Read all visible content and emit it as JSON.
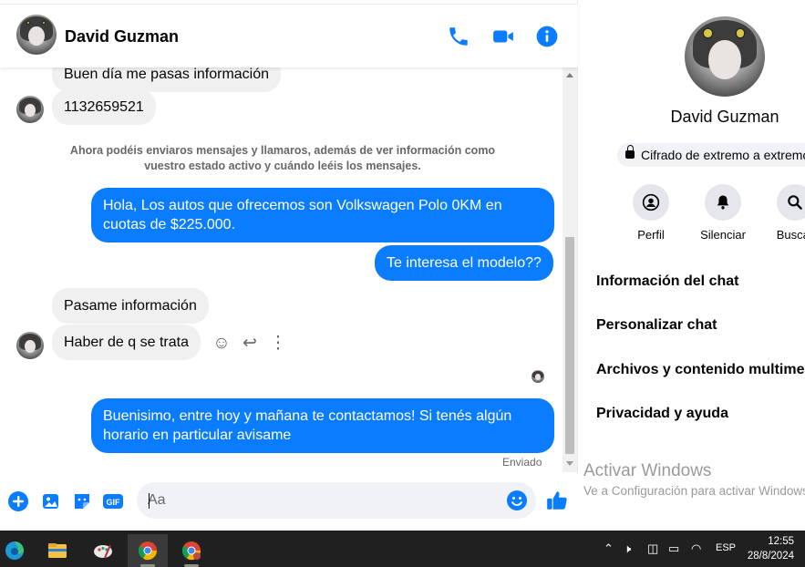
{
  "chat": {
    "contact_name": "David Guzman",
    "messages": {
      "partial_in": "Buen día me pasas información",
      "phone": "1132659521",
      "system_note": "Ahora podéis enviaros mensajes y llamaros, además de ver información como vuestro estado activo y cuándo leéis los mensajes.",
      "out_1": "Hola, Los autos que ofrecemos son Volkswagen Polo 0KM en cuotas de $225.000.",
      "out_2": "Te interesa el modelo??",
      "in_1": "Pasame información",
      "in_2": "Haber de q se trata",
      "out_3": "Buenisimo, entre hoy y mañana te contactamos! Si tenés algún horario en particular avisame",
      "sent_status": "Enviado"
    },
    "composer": {
      "placeholder": "Aa"
    }
  },
  "info_panel": {
    "name": "David Guzman",
    "encryption": "Cifrado de extremo a extremo",
    "actions": {
      "profile": "Perfil",
      "mute": "Silenciar",
      "search": "Buscar"
    },
    "menu": {
      "chat_info": "Información del chat",
      "customize": "Personalizar chat",
      "media": "Archivos y contenido multimedia",
      "privacy": "Privacidad y ayuda"
    },
    "watermark_title": "Activar Windows",
    "watermark_sub": "Ve a Configuración para activar Windows."
  },
  "taskbar": {
    "language": "ESP",
    "time": "12:55",
    "date": "28/8/2024"
  },
  "colors": {
    "messenger_blue": "#0a7cff",
    "incoming_bubble": "#f0f0f0",
    "taskbar": "#202020"
  }
}
